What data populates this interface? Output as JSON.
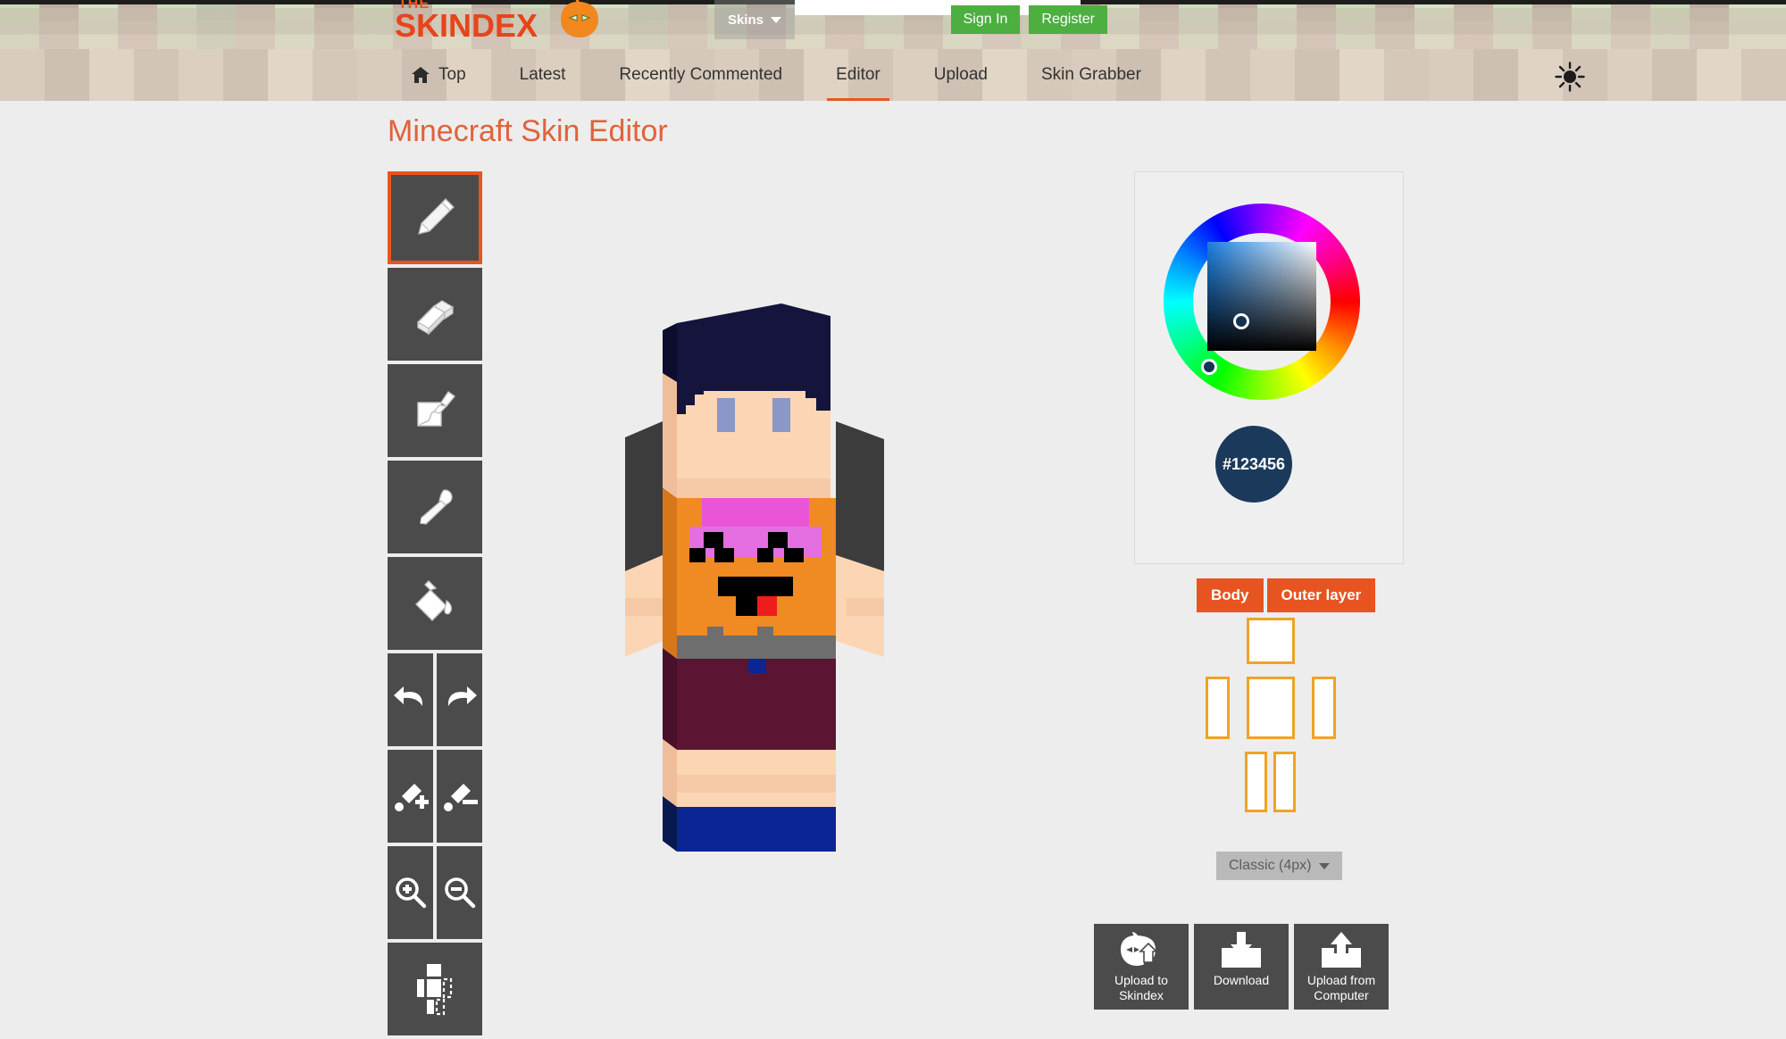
{
  "header": {
    "logo_top": "THE",
    "logo_main": "SKINDEX",
    "logo_icon": "pumpkin-icon",
    "search": {
      "category": "Skins",
      "value": "",
      "placeholder": "",
      "icon": "search-icon"
    },
    "sign_in_label": "Sign In",
    "register_label": "Register",
    "accent_green": "#4caf3f"
  },
  "nav": {
    "items": [
      {
        "label": "Top",
        "icon": "home-icon",
        "active": false
      },
      {
        "label": "Latest",
        "icon": "",
        "active": false
      },
      {
        "label": "Recently Commented",
        "icon": "",
        "active": false
      },
      {
        "label": "Editor",
        "icon": "",
        "active": true
      },
      {
        "label": "Upload",
        "icon": "",
        "active": false
      },
      {
        "label": "Skin Grabber",
        "icon": "",
        "active": false
      }
    ],
    "theme_toggle_icon": "sun-icon",
    "active_underline_color": "#e8561f"
  },
  "page": {
    "title": "Minecraft Skin Editor",
    "title_color": "#e0623c",
    "background": "#ededed"
  },
  "toolbar": {
    "active_border_color": "#e8541f",
    "tile_color": "#4b4b4b",
    "tools": [
      {
        "name": "pencil-tool",
        "icon": "pencil-icon",
        "active": true
      },
      {
        "name": "eraser-tool",
        "icon": "eraser-icon",
        "active": false
      },
      {
        "name": "brush-tool",
        "icon": "marker-icon",
        "active": false
      },
      {
        "name": "eyedropper-tool",
        "icon": "eyedropper-icon",
        "active": false
      },
      {
        "name": "bucket-tool",
        "icon": "paint-bucket-icon",
        "active": false
      }
    ],
    "pairs": [
      {
        "left": {
          "name": "undo-button",
          "icon": "undo-arrow-icon"
        },
        "right": {
          "name": "redo-button",
          "icon": "redo-arrow-icon"
        }
      },
      {
        "left": {
          "name": "brush-size-increase",
          "icon": "brush-plus-icon"
        },
        "right": {
          "name": "brush-size-decrease",
          "icon": "brush-minus-icon"
        }
      },
      {
        "left": {
          "name": "zoom-in-button",
          "icon": "magnifier-plus-icon"
        },
        "right": {
          "name": "zoom-out-button",
          "icon": "magnifier-minus-icon"
        }
      }
    ],
    "last_tool": {
      "name": "body-part-select-tool",
      "icon": "body-parts-icon"
    }
  },
  "color_picker": {
    "hex_value": "#123456",
    "swatch_color": "#1b3a5b",
    "wheel_name": "hue-wheel",
    "square_name": "saturation-value-square"
  },
  "layers": {
    "body_label": "Body",
    "outer_label": "Outer layer",
    "button_color": "#e8541f",
    "part_border_color": "#efa326"
  },
  "model": {
    "selected": "Classic (4px)"
  },
  "actions": [
    {
      "name": "upload-to-skindex-button",
      "label": "Upload to\nSkindex",
      "icon": "pumpkin-upload-icon"
    },
    {
      "name": "download-button",
      "label": "Download",
      "icon": "download-icon"
    },
    {
      "name": "upload-from-computer-button",
      "label": "Upload from\nComputer",
      "icon": "upload-icon"
    }
  ],
  "skin_preview": {
    "name": "minecraft-skin-render",
    "colors": {
      "hair": "#14143c",
      "skin": "#fcd5b4",
      "skin_shade": "#f2c0a0",
      "eye": "#8a97c8",
      "sleeve_dark": "#3c3c3c",
      "shirt_pink": "#ea55d8",
      "shirt_orange": "#f08a23",
      "belt_gray": "#6e6e6e",
      "shorts": "#5c1433",
      "shoes": "#0b2594",
      "mouth": "#000000",
      "tongue": "#ee1c1c"
    }
  }
}
